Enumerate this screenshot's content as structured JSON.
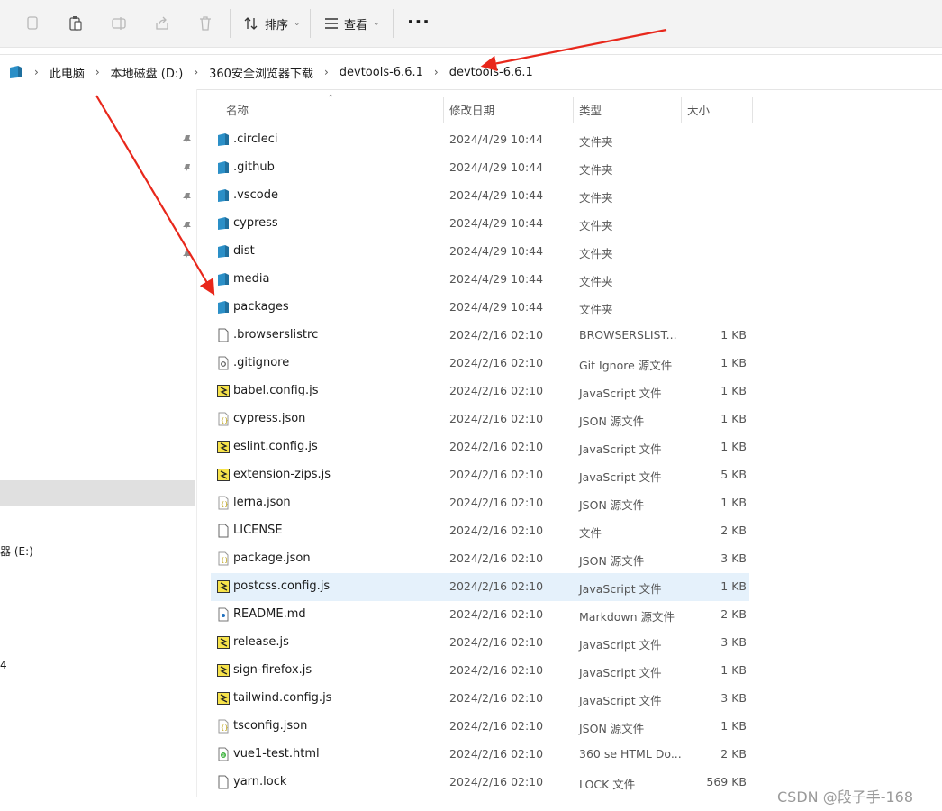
{
  "toolbar": {
    "sort_label": "排序",
    "view_label": "查看",
    "more_label": "···"
  },
  "breadcrumb": [
    "此电脑",
    "本地磁盘 (D:)",
    "360安全浏览器下载",
    "devtools-6.6.1",
    "devtools-6.6.1"
  ],
  "columns": {
    "name": "名称",
    "date": "修改日期",
    "type": "类型",
    "size": "大小"
  },
  "nav_fragments": [
    {
      "text": "器 (E:)"
    },
    {
      "text": "4"
    }
  ],
  "files": [
    {
      "name": ".circleci",
      "date": "2024/4/29 10:44",
      "type": "文件夹",
      "size": "",
      "icon": "folder-icon"
    },
    {
      "name": ".github",
      "date": "2024/4/29 10:44",
      "type": "文件夹",
      "size": "",
      "icon": "folder-icon"
    },
    {
      "name": ".vscode",
      "date": "2024/4/29 10:44",
      "type": "文件夹",
      "size": "",
      "icon": "folder-icon"
    },
    {
      "name": "cypress",
      "date": "2024/4/29 10:44",
      "type": "文件夹",
      "size": "",
      "icon": "folder-icon"
    },
    {
      "name": "dist",
      "date": "2024/4/29 10:44",
      "type": "文件夹",
      "size": "",
      "icon": "folder-icon"
    },
    {
      "name": "media",
      "date": "2024/4/29 10:44",
      "type": "文件夹",
      "size": "",
      "icon": "folder-icon"
    },
    {
      "name": "packages",
      "date": "2024/4/29 10:44",
      "type": "文件夹",
      "size": "",
      "icon": "folder-icon"
    },
    {
      "name": ".browserslistrc",
      "date": "2024/2/16 02:10",
      "type": "BROWSERSLIST...",
      "size": "1 KB",
      "icon": "file-icon"
    },
    {
      "name": ".gitignore",
      "date": "2024/2/16 02:10",
      "type": "Git Ignore 源文件",
      "size": "1 KB",
      "icon": "gear-file-icon"
    },
    {
      "name": "babel.config.js",
      "date": "2024/2/16 02:10",
      "type": "JavaScript 文件",
      "size": "1 KB",
      "icon": "js-file-icon"
    },
    {
      "name": "cypress.json",
      "date": "2024/2/16 02:10",
      "type": "JSON 源文件",
      "size": "1 KB",
      "icon": "json-file-icon"
    },
    {
      "name": "eslint.config.js",
      "date": "2024/2/16 02:10",
      "type": "JavaScript 文件",
      "size": "1 KB",
      "icon": "js-file-icon"
    },
    {
      "name": "extension-zips.js",
      "date": "2024/2/16 02:10",
      "type": "JavaScript 文件",
      "size": "5 KB",
      "icon": "js-file-icon"
    },
    {
      "name": "lerna.json",
      "date": "2024/2/16 02:10",
      "type": "JSON 源文件",
      "size": "1 KB",
      "icon": "json-file-icon"
    },
    {
      "name": "LICENSE",
      "date": "2024/2/16 02:10",
      "type": "文件",
      "size": "2 KB",
      "icon": "file-icon"
    },
    {
      "name": "package.json",
      "date": "2024/2/16 02:10",
      "type": "JSON 源文件",
      "size": "3 KB",
      "icon": "json-file-icon"
    },
    {
      "name": "postcss.config.js",
      "date": "2024/2/16 02:10",
      "type": "JavaScript 文件",
      "size": "1 KB",
      "icon": "js-file-icon",
      "selected": true
    },
    {
      "name": "README.md",
      "date": "2024/2/16 02:10",
      "type": "Markdown 源文件",
      "size": "2 KB",
      "icon": "markdown-file-icon"
    },
    {
      "name": "release.js",
      "date": "2024/2/16 02:10",
      "type": "JavaScript 文件",
      "size": "3 KB",
      "icon": "js-file-icon"
    },
    {
      "name": "sign-firefox.js",
      "date": "2024/2/16 02:10",
      "type": "JavaScript 文件",
      "size": "1 KB",
      "icon": "js-file-icon"
    },
    {
      "name": "tailwind.config.js",
      "date": "2024/2/16 02:10",
      "type": "JavaScript 文件",
      "size": "3 KB",
      "icon": "js-file-icon"
    },
    {
      "name": "tsconfig.json",
      "date": "2024/2/16 02:10",
      "type": "JSON 源文件",
      "size": "1 KB",
      "icon": "json-file-icon"
    },
    {
      "name": "vue1-test.html",
      "date": "2024/2/16 02:10",
      "type": "360 se HTML Do...",
      "size": "2 KB",
      "icon": "html-file-icon"
    },
    {
      "name": "yarn.lock",
      "date": "2024/2/16 02:10",
      "type": "LOCK 文件",
      "size": "569 KB",
      "icon": "file-icon"
    }
  ],
  "watermark": "CSDN @段子手-168",
  "colors": {
    "annotation_arrow": "#e8271b",
    "folder": "#2b8fc7",
    "selected_row": "#e5f1fb"
  }
}
